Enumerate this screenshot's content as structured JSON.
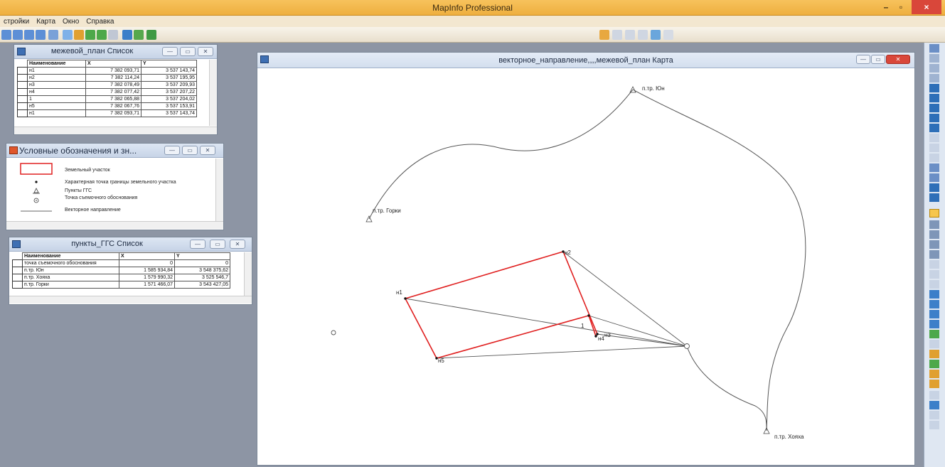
{
  "app": {
    "title": "MapInfo Professional",
    "window_controls": {
      "minimize": "–",
      "maximize": "▫",
      "close": "×"
    }
  },
  "menu": [
    "стройки",
    "Карта",
    "Окно",
    "Справка"
  ],
  "boundary_list": {
    "title": "межевой_план Список",
    "columns": [
      "Наименование",
      "X",
      "Y"
    ],
    "rows": [
      [
        "н1",
        "7 382 093,71",
        "3 537 143,74"
      ],
      [
        "н2",
        "7 382 114,24",
        "3 537 195,95"
      ],
      [
        "н3",
        "7 382 078,49",
        "3 537 209,93"
      ],
      [
        "н4",
        "7 382 077,42",
        "3 537 207,22"
      ],
      [
        "1",
        "7 382 065,88",
        "3 537 204,02"
      ],
      [
        "н5",
        "7 382 067,76",
        "3 537 153,91"
      ],
      [
        "н1",
        "7 382 093,71",
        "3 537 143,74"
      ]
    ]
  },
  "legend": {
    "title": "Условные обозначения и зн...",
    "items": [
      {
        "label": "Земельный участок",
        "symbol": "rect",
        "color": "#e02020"
      },
      {
        "label": "Характерная точка границы земельного участка",
        "symbol": "dot"
      },
      {
        "label": "Пункты ГГС",
        "symbol": "triangle"
      },
      {
        "label": "Точка съемочного обоснования",
        "symbol": "target"
      },
      {
        "label": "Векторное направление",
        "symbol": "line"
      }
    ]
  },
  "ggs_list": {
    "title": "пункты_ГГС Список",
    "columns": [
      "Наименование",
      "X",
      "Y"
    ],
    "rows": [
      [
        "точка съемочного обоснования",
        "0",
        "0"
      ],
      [
        "п.тр. Юн",
        "1 585 934,84",
        "3 548 375,62"
      ],
      [
        "п.тр. Хояха",
        "1 579 990,32",
        "3 525 546,7"
      ],
      [
        "п.тр. Горки",
        "1 571 466,07",
        "3 543 427,05"
      ]
    ]
  },
  "map_window": {
    "title": "векторное_направление,,,,межевой_план Карта",
    "labels": {
      "yun": "п.тр. Юн",
      "gorki": "п.тр. Горки",
      "hoyaha": "п.тр. Хояха",
      "n1": "н1",
      "n2": "н2",
      "n3": "н3",
      "n4": "н4",
      "n5": "н5",
      "p1": "1"
    },
    "colors": {
      "parcel": "#e02020",
      "vector": "#555555"
    }
  }
}
